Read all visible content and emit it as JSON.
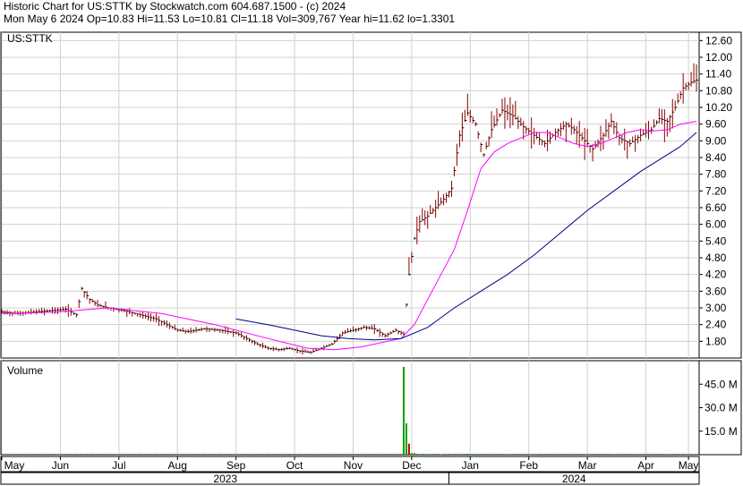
{
  "header": {
    "title": "Historic Chart for US:STTK by Stockwatch.com 604.687.1500 - (c) 2024",
    "summary": "Mon May  6 2024   Op=10.83   Hi=11.53   Lo=10.81   Cl=11.18   Vol=309,767   Year hi=11.62   lo=1.3301"
  },
  "colors": {
    "price_bar": "#8b0000",
    "ma_short": "#ff00ff",
    "ma_long": "#00008b",
    "volume_up": "#00a000",
    "volume_down": "#c00000",
    "grid": "#d0d0d0",
    "frame": "#000000"
  },
  "chart_data": [
    {
      "type": "line",
      "panel": "price",
      "label": "US:STTK",
      "yticks": [
        "12.60",
        "12.00",
        "11.40",
        "10.80",
        "10.20",
        "9.60",
        "9.00",
        "8.40",
        "7.80",
        "7.20",
        "6.60",
        "6.00",
        "5.40",
        "4.80",
        "4.20",
        "3.60",
        "3.00",
        "2.40",
        "1.80"
      ],
      "ylim": [
        1.2,
        12.9
      ],
      "xlim": [
        0,
        262
      ],
      "grid": true,
      "ohlc_points": [
        [
          0,
          2.85
        ],
        [
          6,
          2.8
        ],
        [
          12,
          2.85
        ],
        [
          18,
          2.9
        ],
        [
          24,
          2.95
        ],
        [
          28,
          2.75
        ],
        [
          30,
          3.7
        ],
        [
          33,
          3.3
        ],
        [
          36,
          3.1
        ],
        [
          40,
          3.0
        ],
        [
          46,
          2.9
        ],
        [
          52,
          2.75
        ],
        [
          58,
          2.6
        ],
        [
          62,
          2.4
        ],
        [
          66,
          2.2
        ],
        [
          70,
          2.15
        ],
        [
          76,
          2.25
        ],
        [
          82,
          2.2
        ],
        [
          88,
          2.1
        ],
        [
          92,
          1.9
        ],
        [
          96,
          1.7
        ],
        [
          100,
          1.55
        ],
        [
          104,
          1.5
        ],
        [
          108,
          1.55
        ],
        [
          112,
          1.45
        ],
        [
          116,
          1.4
        ],
        [
          120,
          1.55
        ],
        [
          124,
          1.7
        ],
        [
          128,
          2.1
        ],
        [
          132,
          2.2
        ],
        [
          136,
          2.3
        ],
        [
          140,
          2.25
        ],
        [
          144,
          2.0
        ],
        [
          148,
          2.2
        ],
        [
          151,
          2.05
        ],
        [
          153,
          4.2
        ],
        [
          155,
          5.5
        ],
        [
          157,
          6.1
        ],
        [
          160,
          6.3
        ],
        [
          163,
          6.6
        ],
        [
          166,
          6.9
        ],
        [
          169,
          7.3
        ],
        [
          172,
          9.2
        ],
        [
          175,
          10.0
        ],
        [
          178,
          9.6
        ],
        [
          181,
          8.5
        ],
        [
          184,
          9.4
        ],
        [
          188,
          10.1
        ],
        [
          192,
          9.9
        ],
        [
          196,
          9.5
        ],
        [
          200,
          9.2
        ],
        [
          204,
          8.9
        ],
        [
          208,
          9.3
        ],
        [
          212,
          9.6
        ],
        [
          215,
          9.4
        ],
        [
          218,
          9.1
        ],
        [
          222,
          8.7
        ],
        [
          226,
          9.2
        ],
        [
          229,
          9.7
        ],
        [
          232,
          9.1
        ],
        [
          236,
          8.9
        ],
        [
          240,
          9.2
        ],
        [
          244,
          9.4
        ],
        [
          247,
          9.8
        ],
        [
          250,
          9.7
        ],
        [
          253,
          10.2
        ],
        [
          256,
          10.9
        ],
        [
          259,
          11.1
        ],
        [
          261,
          11.18
        ]
      ],
      "series": [
        {
          "name": "short moving average",
          "points": [
            [
              0,
              2.8
            ],
            [
              20,
              2.85
            ],
            [
              40,
              3.0
            ],
            [
              60,
              2.8
            ],
            [
              80,
              2.4
            ],
            [
              100,
              1.9
            ],
            [
              115,
              1.55
            ],
            [
              125,
              1.5
            ],
            [
              135,
              1.6
            ],
            [
              145,
              1.8
            ],
            [
              150,
              1.9
            ],
            [
              155,
              2.4
            ],
            [
              160,
              3.3
            ],
            [
              165,
              4.2
            ],
            [
              170,
              5.1
            ],
            [
              175,
              6.5
            ],
            [
              180,
              8.0
            ],
            [
              185,
              8.6
            ],
            [
              190,
              8.9
            ],
            [
              195,
              9.1
            ],
            [
              200,
              9.3
            ],
            [
              205,
              9.3
            ],
            [
              210,
              9.1
            ],
            [
              215,
              8.9
            ],
            [
              220,
              8.8
            ],
            [
              225,
              8.9
            ],
            [
              230,
              9.1
            ],
            [
              235,
              9.3
            ],
            [
              240,
              9.4
            ],
            [
              245,
              9.35
            ],
            [
              250,
              9.4
            ],
            [
              255,
              9.6
            ],
            [
              261,
              9.7
            ]
          ]
        },
        {
          "name": "long moving average",
          "points": [
            [
              88,
              2.6
            ],
            [
              100,
              2.4
            ],
            [
              110,
              2.2
            ],
            [
              120,
              2.0
            ],
            [
              130,
              1.9
            ],
            [
              140,
              1.85
            ],
            [
              150,
              1.9
            ],
            [
              160,
              2.3
            ],
            [
              170,
              3.0
            ],
            [
              180,
              3.6
            ],
            [
              190,
              4.2
            ],
            [
              200,
              4.9
            ],
            [
              210,
              5.7
            ],
            [
              220,
              6.5
            ],
            [
              230,
              7.2
            ],
            [
              240,
              7.9
            ],
            [
              250,
              8.5
            ],
            [
              255,
              8.8
            ],
            [
              261,
              9.3
            ]
          ]
        }
      ]
    },
    {
      "type": "bar",
      "panel": "volume",
      "label": "Volume",
      "yticks": [
        "45.0 M",
        "30.0 M",
        "15.0 M"
      ],
      "ylim": [
        0,
        60
      ],
      "bars": [
        [
          151,
          56
        ],
        [
          152,
          20
        ],
        [
          153,
          7
        ],
        [
          154,
          1
        ],
        [
          155,
          1
        ],
        [
          156,
          0.6
        ],
        [
          157,
          0.4
        ],
        [
          160,
          0.3
        ],
        [
          165,
          0.3
        ],
        [
          170,
          0.5
        ],
        [
          175,
          0.6
        ],
        [
          180,
          0.4
        ],
        [
          190,
          0.3
        ],
        [
          200,
          0.4
        ],
        [
          210,
          0.5
        ],
        [
          220,
          0.3
        ],
        [
          230,
          0.3
        ],
        [
          240,
          0.4
        ],
        [
          250,
          0.3
        ],
        [
          260,
          0.3
        ]
      ]
    }
  ],
  "x_axis": {
    "months": [
      {
        "label": "May",
        "x": 0
      },
      {
        "label": "Jun",
        "x": 22
      },
      {
        "label": "Jul",
        "x": 44
      },
      {
        "label": "Aug",
        "x": 66
      },
      {
        "label": "Sep",
        "x": 88
      },
      {
        "label": "Oct",
        "x": 110
      },
      {
        "label": "Nov",
        "x": 132
      },
      {
        "label": "Dec",
        "x": 154
      },
      {
        "label": "Jan",
        "x": 176
      },
      {
        "label": "Feb",
        "x": 198
      },
      {
        "label": "Mar",
        "x": 220
      },
      {
        "label": "Apr",
        "x": 242
      },
      {
        "label": "May",
        "x": 258
      }
    ],
    "years": [
      {
        "label": "2023",
        "from": 0,
        "to": 168
      },
      {
        "label": "2024",
        "from": 168,
        "to": 262
      }
    ]
  }
}
